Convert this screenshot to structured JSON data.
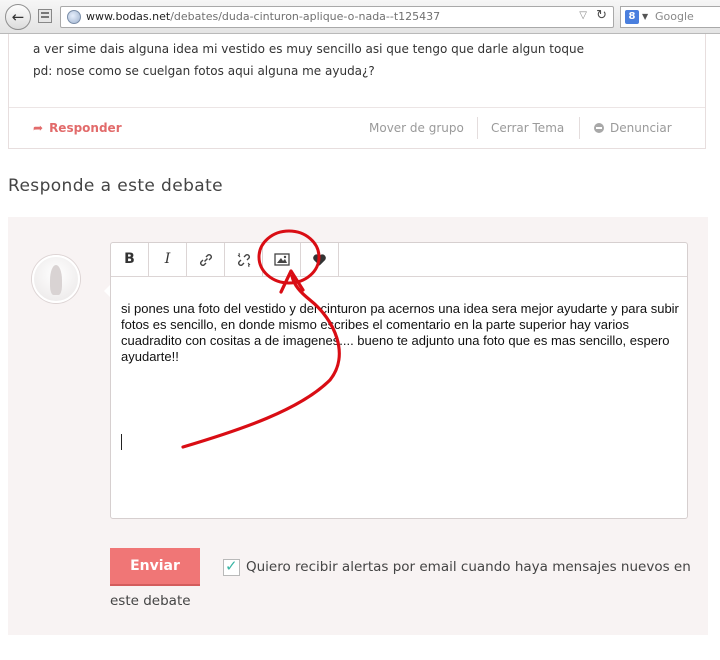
{
  "browser": {
    "back_glyph": "←",
    "url_domain": "www.bodas.net",
    "url_path": "/debates/duda-cinturon-aplique-o-nada--t125437",
    "search_icon_glyph": "8",
    "search_placeholder": "Google"
  },
  "post": {
    "line1": "a ver sime dais alguna idea mi vestido es muy sencillo asi que tengo que darle algun toque",
    "line2": "pd: nose como se cuelgan fotos aqui alguna me ayuda¿?",
    "reply_label": "Responder",
    "move_label": "Mover de grupo",
    "close_label": "Cerrar Tema",
    "denounce_label": "Denunciar"
  },
  "reply_section": {
    "title": "Responde a este debate",
    "toolbar": {
      "bold": "B",
      "italic": "I",
      "link": "link-icon",
      "unlink": "unlink-icon",
      "image": "image-icon",
      "heart": "heart-icon"
    },
    "editor_text": "si pones una foto del vestido y del cinturon pa acernos una idea sera mejor ayudarte y para subir fotos es sencillo, en donde mismo escribes el comentario en la parte superior hay varios cuadradito con cositas a de imagenes.... bueno te adjunto una foto que es mas sencillo, espero ayudarte!!",
    "send_label": "Enviar",
    "alerts_checked": true,
    "alerts_label_line1": "Quiero recibir alertas por email cuando haya mensajes nuevos en",
    "alerts_label_line2": "este debate"
  },
  "colors": {
    "accent": "#f07676",
    "link": "#e26b6b",
    "annotation": "#d90d14",
    "check": "#3ab5a5"
  }
}
